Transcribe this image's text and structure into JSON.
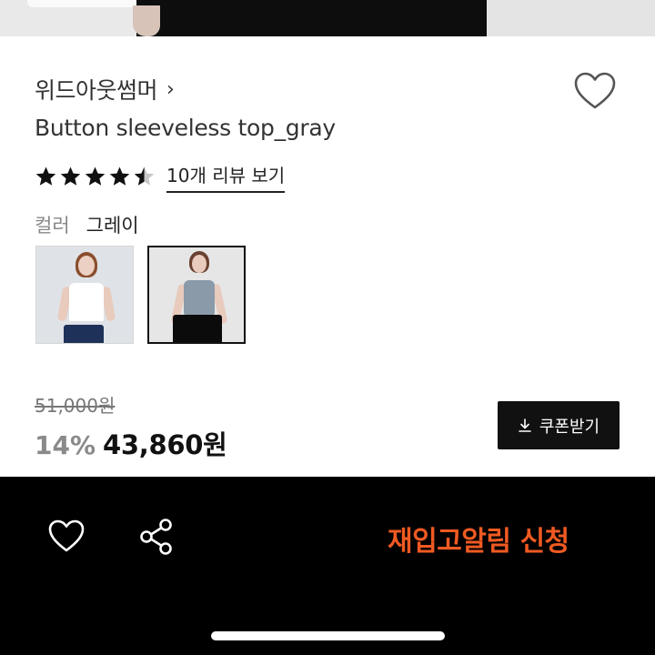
{
  "brand": {
    "name": "위드아웃썸머",
    "chevron": "›"
  },
  "product": {
    "title": "Button sleeveless top_gray",
    "rating": 4.5,
    "stars_total": 5,
    "review_link": "10개 리뷰 보기"
  },
  "color": {
    "label": "컬러",
    "selected": "그레이",
    "swatches": [
      {
        "name": "white",
        "selected": false
      },
      {
        "name": "gray",
        "selected": true
      }
    ]
  },
  "price": {
    "original": "51,000원",
    "discount": "14%",
    "sale": "43,860원"
  },
  "coupon": {
    "label": "쿠폰받기",
    "icon": "download-icon"
  },
  "bottom_bar": {
    "wish_icon": "heart-outline-icon",
    "share_icon": "share-icon",
    "restock_label": "재입고알림 신청",
    "restock_color": "#f05a22"
  }
}
